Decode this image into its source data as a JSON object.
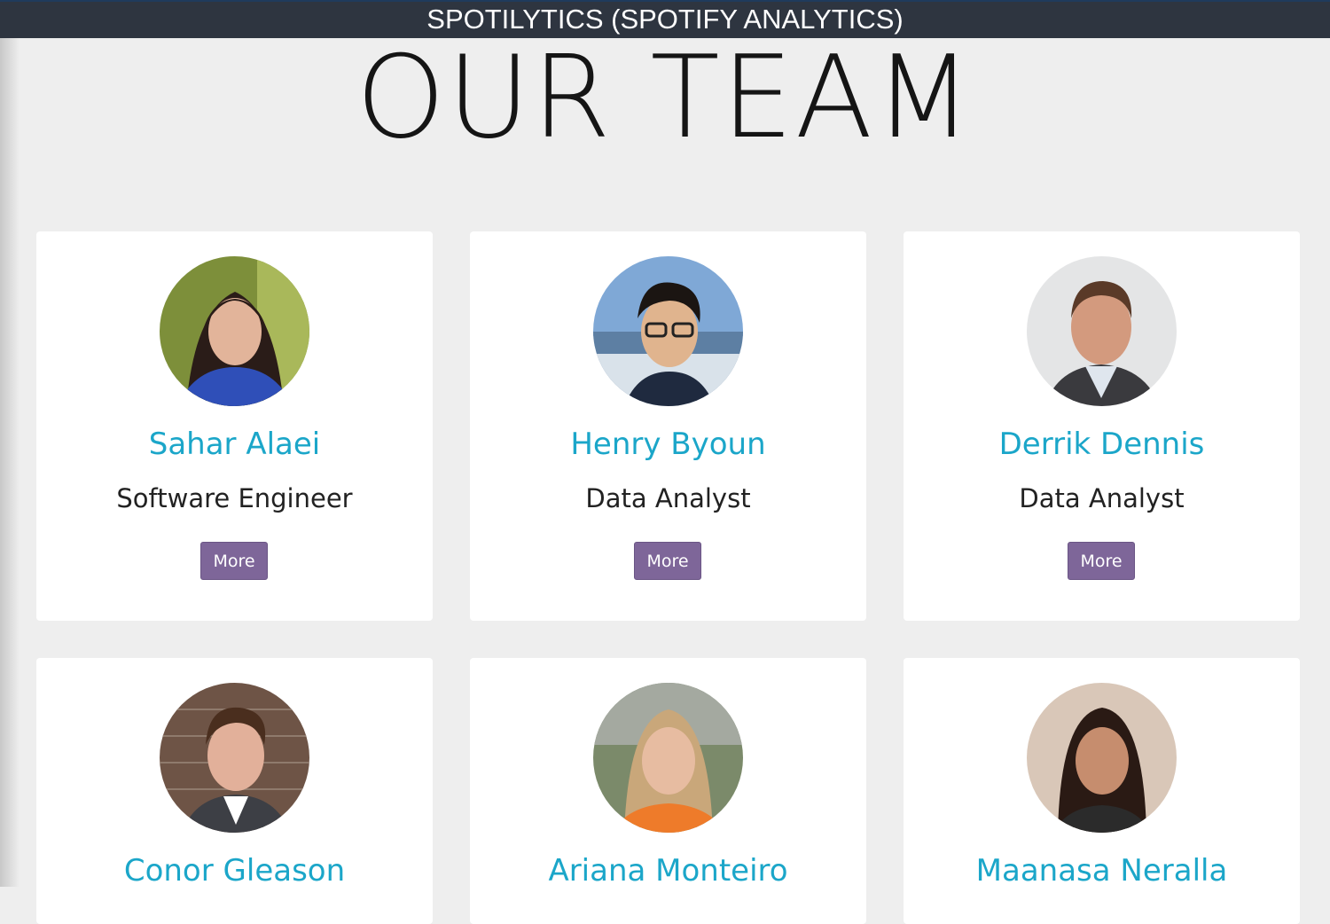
{
  "header": {
    "title": "SPOTILYTICS (SPOTIFY ANALYTICS)"
  },
  "page": {
    "title": "OUR TEAM"
  },
  "team": [
    {
      "name": "Sahar Alaei",
      "role": "Software Engineer",
      "more_label": "More"
    },
    {
      "name": "Henry Byoun",
      "role": "Data Analyst",
      "more_label": "More"
    },
    {
      "name": "Derrik Dennis",
      "role": "Data Analyst",
      "more_label": "More"
    },
    {
      "name": "Conor Gleason"
    },
    {
      "name": "Ariana Monteiro"
    },
    {
      "name": "Maanasa Neralla"
    }
  ],
  "colors": {
    "accent": "#1ba6c9",
    "button": "#7e6699",
    "topbar": "#2e3540",
    "background": "#eeeeee"
  }
}
